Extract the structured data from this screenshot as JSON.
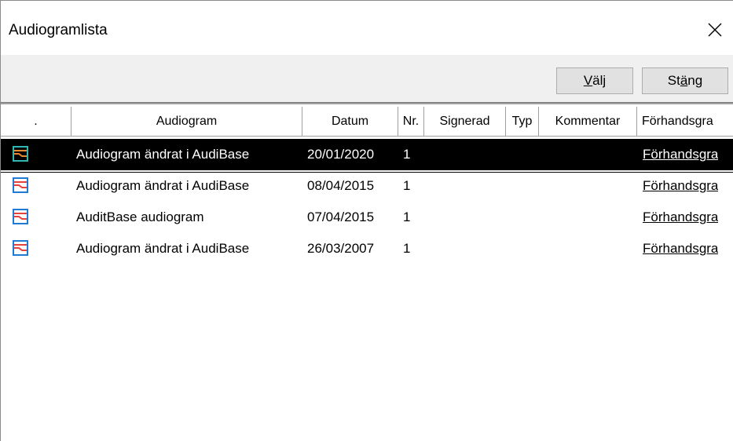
{
  "window": {
    "title": "Audiogramlista"
  },
  "toolbar": {
    "select_label_pre": "",
    "select_label_ul": "V",
    "select_label_post": "älj",
    "close_label_pre": "St",
    "close_label_ul": "ä",
    "close_label_post": "ng"
  },
  "columns": [
    ".",
    "Audiogram",
    "Datum",
    "Nr.",
    "Signerad",
    "Typ",
    "Kommentar",
    "Förhandsgra"
  ],
  "rows": [
    {
      "audiogram": "Audiogram ändrat i AudiBase",
      "datum": "20/01/2020",
      "nr": "1",
      "signerad": "",
      "typ": "",
      "kommentar": "",
      "preview": "Förhandsgra",
      "selected": true
    },
    {
      "audiogram": "Audiogram ändrat i AudiBase",
      "datum": "08/04/2015",
      "nr": "1",
      "signerad": "",
      "typ": "",
      "kommentar": "",
      "preview": "Förhandsgra",
      "selected": false
    },
    {
      "audiogram": "AuditBase audiogram",
      "datum": "07/04/2015",
      "nr": "1",
      "signerad": "",
      "typ": "",
      "kommentar": "",
      "preview": "Förhandsgra",
      "selected": false
    },
    {
      "audiogram": "Audiogram ändrat i AudiBase",
      "datum": "26/03/2007",
      "nr": "1",
      "signerad": "",
      "typ": "",
      "kommentar": "",
      "preview": "Förhandsgra",
      "selected": false
    }
  ],
  "icons": {
    "row_icon": "audiogram-icon",
    "close": "close-icon"
  },
  "colors": {
    "icon_blue": "#1f7ad6",
    "icon_red": "#e8403a",
    "icon_orange": "#e88a2a",
    "icon_teal": "#2fb7b0",
    "selection": "#000000"
  }
}
